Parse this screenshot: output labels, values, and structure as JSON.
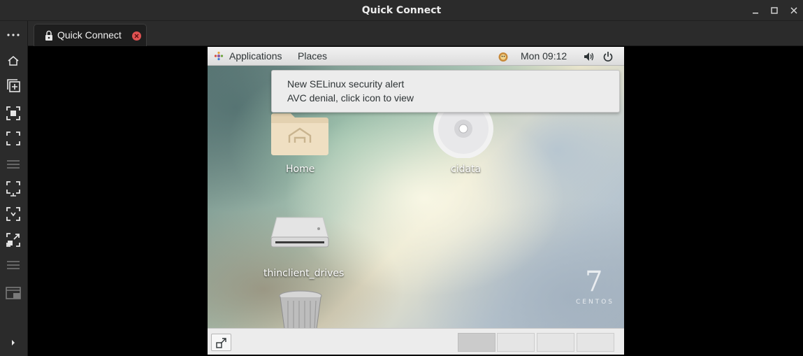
{
  "window": {
    "title": "Quick Connect"
  },
  "tab": {
    "label": "Quick Connect"
  },
  "remote": {
    "top_panel": {
      "applications_label": "Applications",
      "places_label": "Places",
      "clock": "Mon 09:12"
    },
    "notification": {
      "title": "New SELinux security alert",
      "body": "AVC denial, click icon to view"
    },
    "desktop_icons": [
      {
        "label": "Home",
        "icon": "home-folder-icon"
      },
      {
        "label": "cidata",
        "icon": "cd-disc-icon"
      },
      {
        "label": "thinclient_drives",
        "icon": "drive-icon"
      },
      {
        "label": "",
        "icon": "trash-icon"
      }
    ],
    "branding": {
      "version": "7",
      "name": "CENTOS"
    },
    "workspaces": {
      "count": 4,
      "active": 1
    }
  },
  "colors": {
    "chrome_bg": "#2b2b2b",
    "tab_close": "#e05252",
    "panel_bg": "#ececec"
  }
}
